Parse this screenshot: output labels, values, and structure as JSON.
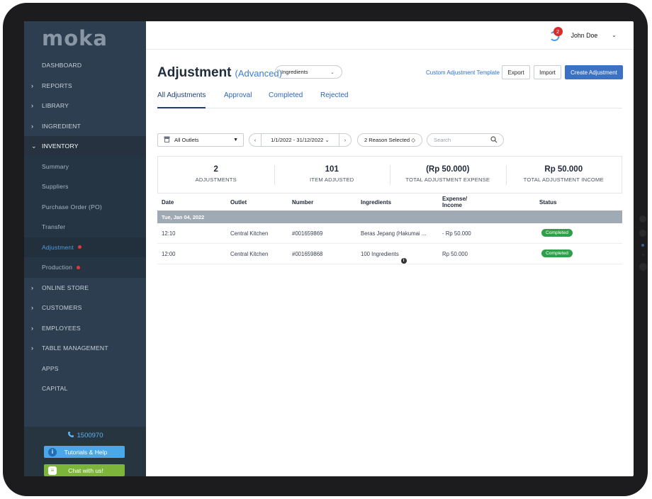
{
  "brand": {
    "logo": "moka"
  },
  "sidebar": {
    "items": [
      {
        "label": "DASHBOARD",
        "chevron": ""
      },
      {
        "label": "REPORTS",
        "chevron": "›"
      },
      {
        "label": "LIBRARY",
        "chevron": "›"
      },
      {
        "label": "INGREDIENT",
        "chevron": "›"
      },
      {
        "label": "INVENTORY",
        "chevron": "⌄"
      },
      {
        "label": "Summary"
      },
      {
        "label": "Suppliers"
      },
      {
        "label": "Purchase Order (PO)"
      },
      {
        "label": "Transfer"
      },
      {
        "label": "Adjustment"
      },
      {
        "label": "Production"
      },
      {
        "label": "ONLINE STORE",
        "chevron": "›"
      },
      {
        "label": "CUSTOMERS",
        "chevron": "›"
      },
      {
        "label": "EMPLOYEES",
        "chevron": "›"
      },
      {
        "label": "TABLE MANAGEMENT",
        "chevron": "›"
      },
      {
        "label": "APPS"
      },
      {
        "label": "CAPITAL"
      }
    ],
    "phone": "1500970",
    "help_label": "Tutorials & Help",
    "chat_label": "Chat with us!"
  },
  "topbar": {
    "notification_count": "2",
    "user_name": "John Doe",
    "user_chevron": "⌄"
  },
  "page": {
    "title": "Adjustment",
    "subtitle": "(Advanced)",
    "type_select": "Ingredients",
    "custom_link": "Custom Adjustment Template",
    "export_label": "Export",
    "import_label": "Import",
    "create_label": "Create Adjustment"
  },
  "tabs": [
    "All Adjustments",
    "Approval",
    "Completed",
    "Rejected"
  ],
  "filters": {
    "outlet": "All Outlets",
    "date_range": "1/1/2022 - 31/12/2022 ⌄",
    "prev": "‹",
    "next": "›",
    "reason": "2 Reason Selected ◇",
    "search_placeholder": "Search"
  },
  "summary": [
    {
      "value": "2",
      "label": "ADJUSTMENTS"
    },
    {
      "value": "101",
      "label": "ITEM ADJUSTED"
    },
    {
      "value": "(Rp 50.000)",
      "label": "TOTAL ADJUSTMENT EXPENSE"
    },
    {
      "value": "Rp 50.000",
      "label": "TOTAL ADJUSTMENT INCOME"
    }
  ],
  "table": {
    "headers": {
      "date": "Date",
      "outlet": "Outlet",
      "number": "Number",
      "ingredients": "Ingredients",
      "expense_line1": "Expense/",
      "expense_line2": "Income",
      "status": "Status"
    },
    "group_label": "Tue, Jan 04, 2022",
    "rows": [
      {
        "date": "12:10",
        "outlet": "Central Kitchen",
        "number": "#001659869",
        "ingredients": "Beras Jepang (Hakumai ...",
        "amount": "- Rp 50.000",
        "status": "Completed"
      },
      {
        "date": "12:00",
        "outlet": "Central Kitchen",
        "number": "#001659868",
        "ingredients": "100 Ingredients",
        "amount": "Rp 50.000",
        "status": "Completed"
      }
    ]
  },
  "colors": {
    "sidebar_bg": "#2d3e50",
    "accent_blue": "#3b72c4",
    "status_green": "#2f9f4a",
    "help_blue": "#4aa8e8",
    "chat_green": "#7db53a"
  }
}
